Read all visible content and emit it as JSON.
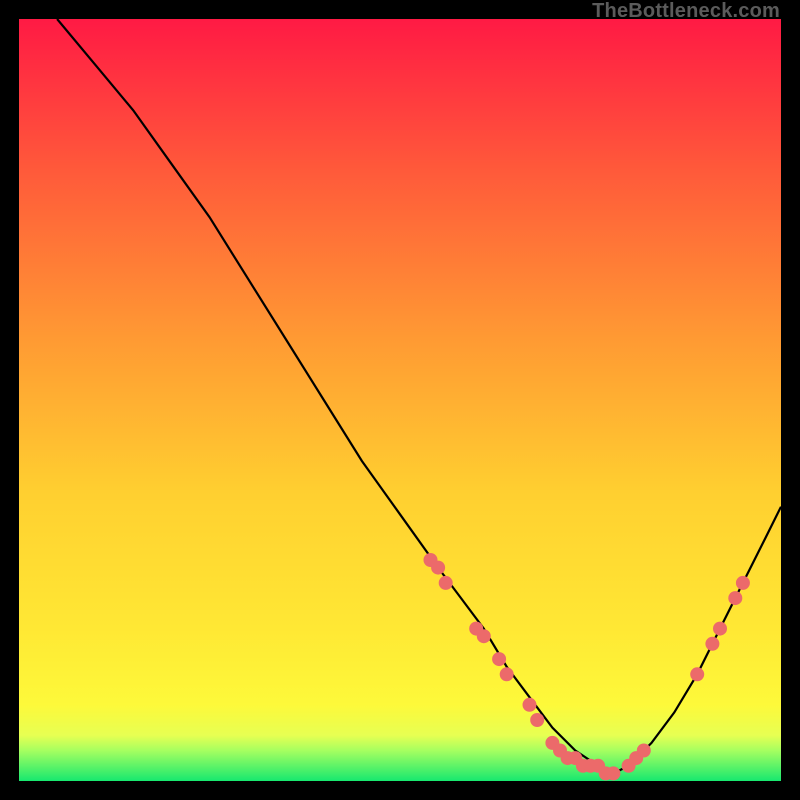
{
  "watermark": "TheBottleneck.com",
  "chart_data": {
    "type": "line",
    "title": "",
    "xlabel": "",
    "ylabel": "",
    "xlim": [
      0,
      100
    ],
    "ylim": [
      0,
      100
    ],
    "grid": false,
    "legend": false,
    "background_gradient": {
      "top_color": "#ff1a44",
      "mid_color": "#ffe236",
      "bottom_color": "#17e86f",
      "bottom_band_start_pct": 94
    },
    "series": [
      {
        "name": "bottleneck-curve",
        "color": "#000000",
        "x": [
          5,
          10,
          15,
          20,
          25,
          30,
          35,
          40,
          45,
          50,
          55,
          58,
          61,
          64,
          67,
          70,
          73,
          76,
          78,
          80,
          83,
          86,
          89,
          92,
          95,
          98,
          100
        ],
        "y": [
          100,
          94,
          88,
          81,
          74,
          66,
          58,
          50,
          42,
          35,
          28,
          24,
          20,
          15,
          11,
          7,
          4,
          2,
          1,
          2,
          5,
          9,
          14,
          20,
          26,
          32,
          36
        ]
      }
    ],
    "scatter_points": {
      "name": "markers",
      "color": "#ec6a6a",
      "radius_px": 7,
      "points": [
        {
          "x": 54,
          "y": 29
        },
        {
          "x": 55,
          "y": 28
        },
        {
          "x": 56,
          "y": 26
        },
        {
          "x": 60,
          "y": 20
        },
        {
          "x": 61,
          "y": 19
        },
        {
          "x": 63,
          "y": 16
        },
        {
          "x": 64,
          "y": 14
        },
        {
          "x": 67,
          "y": 10
        },
        {
          "x": 68,
          "y": 8
        },
        {
          "x": 70,
          "y": 5
        },
        {
          "x": 71,
          "y": 4
        },
        {
          "x": 72,
          "y": 3
        },
        {
          "x": 73,
          "y": 3
        },
        {
          "x": 74,
          "y": 2
        },
        {
          "x": 75,
          "y": 2
        },
        {
          "x": 76,
          "y": 2
        },
        {
          "x": 77,
          "y": 1
        },
        {
          "x": 78,
          "y": 1
        },
        {
          "x": 80,
          "y": 2
        },
        {
          "x": 81,
          "y": 3
        },
        {
          "x": 82,
          "y": 4
        },
        {
          "x": 89,
          "y": 14
        },
        {
          "x": 91,
          "y": 18
        },
        {
          "x": 92,
          "y": 20
        },
        {
          "x": 94,
          "y": 24
        },
        {
          "x": 95,
          "y": 26
        }
      ]
    }
  }
}
